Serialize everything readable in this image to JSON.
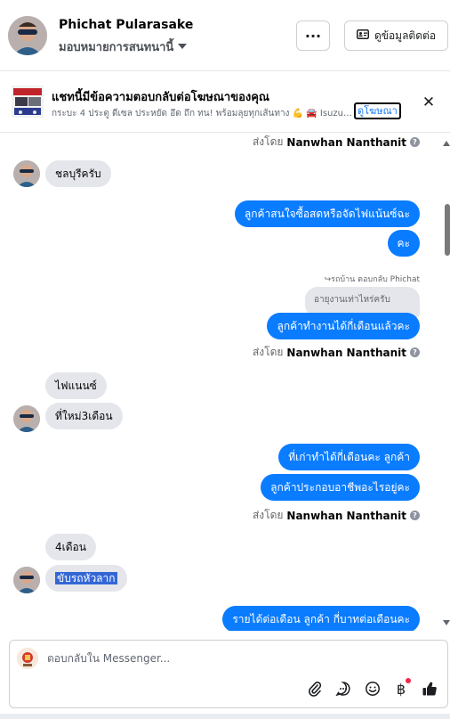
{
  "header": {
    "name": "Phichat Pularasake",
    "status": "มอบหมายการสนทนานี้",
    "more_label": "···",
    "contact_label": "ดูข้อมูลติดต่อ",
    "contact_icon": "contact-card-icon"
  },
  "ad_banner": {
    "title": "แชทนี้มีข้อความตอบกลับต่อโฆษณาของคุณ",
    "subtitle": "กระบะ 4 ประตู ดีเซล ประหยัด อึด ถึก ทน! พร้อมลุยทุกเส้นทาง 💪 🚘 Isuzu D-Max",
    "link_label": "ดูโฆษณา",
    "close_icon": "close-icon"
  },
  "thread": {
    "sent_by_prefix": "ส่งโดย",
    "sent_by_name": "Nanwhan Nanthanit",
    "messages": [
      {
        "id": "m1",
        "side": "in",
        "text": "ชลบุรีครับ"
      },
      {
        "id": "m2",
        "side": "out",
        "text": "ลูกค้าสนใจซื้อสดหรือจัดไฟแน้นซ์ฉะ"
      },
      {
        "id": "m3",
        "side": "out",
        "text": "คะ"
      },
      {
        "id": "m4",
        "side": "out",
        "text": "ลูกค้าทำงานได้กี่เดือนแล้วคะ"
      },
      {
        "id": "m5",
        "side": "in",
        "text": "ไฟแนนซ์"
      },
      {
        "id": "m6",
        "side": "in",
        "text": "ที่ใหม่3เดือน"
      },
      {
        "id": "m7",
        "side": "out",
        "text": "ที่เก่าทำได้กี่เดือนคะ  ลูกค้า"
      },
      {
        "id": "m8",
        "side": "out",
        "text": "ลูกค้าประกอบอาชีพอะไรอยู่คะ"
      },
      {
        "id": "m9",
        "side": "in",
        "text": "4เดือน"
      },
      {
        "id": "m10",
        "side": "in",
        "text": "ขับรถหัวลาก"
      },
      {
        "id": "m11",
        "side": "out",
        "text": "รายได้ต่อเดือน ลูกค้า กี่บาทต่อเดือนคะ"
      }
    ],
    "reply": {
      "label": "↪รถบ้าน ตอบกลับ Phichat",
      "quoted_text": "อายุงานเท่าไหร่ครับ"
    }
  },
  "composer": {
    "placeholder": "ตอบกลับใน Messenger...",
    "icons": [
      "attach-icon",
      "saved-reply-icon",
      "emoji-icon",
      "baht-icon",
      "like-icon"
    ]
  },
  "colors": {
    "outgoing_bubble": "#0a7cff",
    "incoming_bubble": "#e4e6eb",
    "selection": "#3367d6",
    "notification_dot": "#f02849"
  }
}
